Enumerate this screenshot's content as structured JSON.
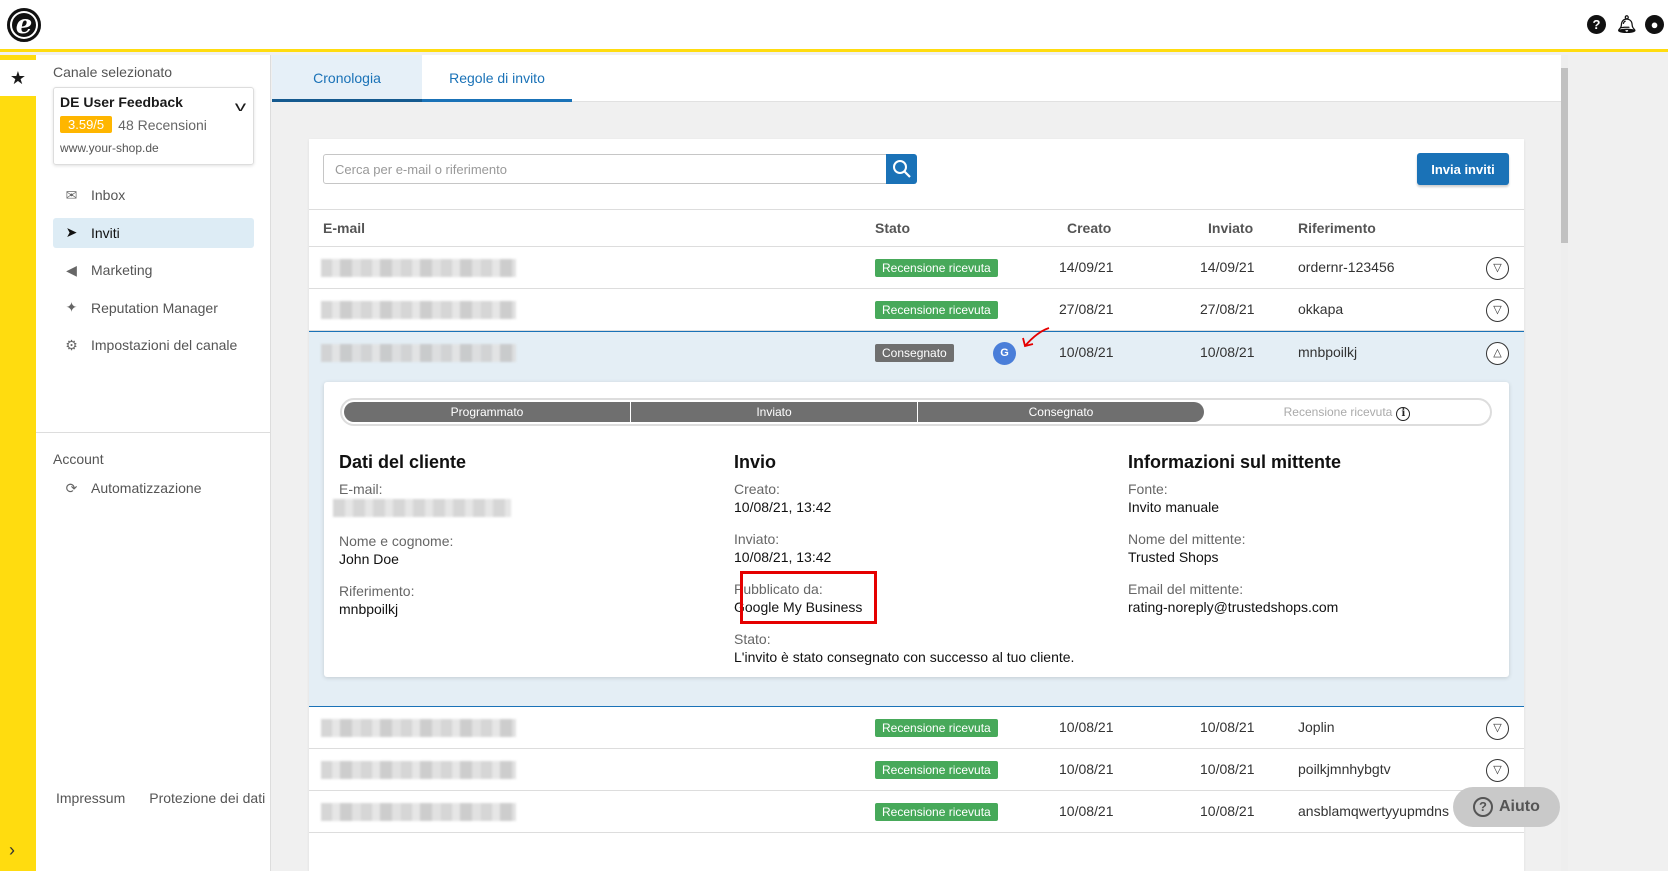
{
  "header": {
    "logo": "e",
    "icons": [
      "help-icon",
      "bell-icon",
      "user-icon"
    ]
  },
  "sidebar": {
    "channel_label": "Canale selezionato",
    "channel": {
      "name": "DE User Feedback",
      "rating": "3.59/5",
      "reviews": "48 Recensioni",
      "url": "www.your-shop.de"
    },
    "nav": [
      {
        "label": "Inbox",
        "icon": "inbox-icon"
      },
      {
        "label": "Inviti",
        "icon": "send-icon",
        "active": true
      },
      {
        "label": "Marketing",
        "icon": "megaphone-icon"
      },
      {
        "label": "Reputation Manager",
        "icon": "sparkle-icon"
      },
      {
        "label": "Impostazioni del canale",
        "icon": "gear-icon"
      }
    ],
    "account_label": "Account",
    "account_items": [
      {
        "label": "Automatizzazione",
        "icon": "automation-icon"
      }
    ],
    "footer": {
      "impressum": "Impressum",
      "privacy": "Protezione dei dati"
    }
  },
  "tabs": [
    {
      "label": "Cronologia",
      "active": true
    },
    {
      "label": "Regole di invito"
    }
  ],
  "toolbar": {
    "search_placeholder": "Cerca per e-mail o riferimento",
    "invite_button": "Invia inviti"
  },
  "table": {
    "headers": {
      "email": "E-mail",
      "status": "Stato",
      "created": "Creato",
      "sent": "Inviato",
      "reference": "Riferimento"
    },
    "rows": [
      {
        "status": "Recensione ricevuta",
        "created": "14/09/21",
        "sent": "14/09/21",
        "reference": "ordernr-123456"
      },
      {
        "status": "Recensione ricevuta",
        "created": "27/08/21",
        "sent": "27/08/21",
        "reference": "okkapa"
      },
      {
        "status": "Consegnato",
        "badge": "G",
        "created": "10/08/21",
        "sent": "10/08/21",
        "reference": "mnbpoilkj"
      },
      {
        "status": "Recensione ricevuta",
        "created": "10/08/21",
        "sent": "10/08/21",
        "reference": "Joplin"
      },
      {
        "status": "Recensione ricevuta",
        "created": "10/08/21",
        "sent": "10/08/21",
        "reference": "poilkjmnhybgtv"
      },
      {
        "status": "Recensione ricevuta",
        "created": "10/08/21",
        "sent": "10/08/21",
        "reference": "ansblamqwertyyupmdns"
      }
    ]
  },
  "detail": {
    "progress": [
      "Programmato",
      "Inviato",
      "Consegnato",
      "Recensione ricevuta"
    ],
    "customer": {
      "title": "Dati del cliente",
      "email_label": "E-mail:",
      "name_label": "Nome e cognome:",
      "name": "John Doe",
      "ref_label": "Riferimento:",
      "ref": "mnbpoilkj"
    },
    "sending": {
      "title": "Invio",
      "created_label": "Creato:",
      "created": "10/08/21, 13:42",
      "sent_label": "Inviato:",
      "sent": "10/08/21, 13:42",
      "published_label": "Pubblicato da:",
      "published": "Google My Business",
      "state_label": "Stato:",
      "state": "L'invito è stato consegnato con successo al tuo cliente."
    },
    "sender": {
      "title": "Informazioni sul mittente",
      "source_label": "Fonte:",
      "source": "Invito manuale",
      "name_label": "Nome del mittente:",
      "name": "Trusted Shops",
      "email_label": "Email del mittente:",
      "email": "rating-noreply@trustedshops.com"
    }
  },
  "help": {
    "label": "Aiuto"
  },
  "colors": {
    "accent": "#1a72b7",
    "yellow": "#ffdc0f",
    "success": "#47a95a",
    "highlight": "#e50000"
  }
}
